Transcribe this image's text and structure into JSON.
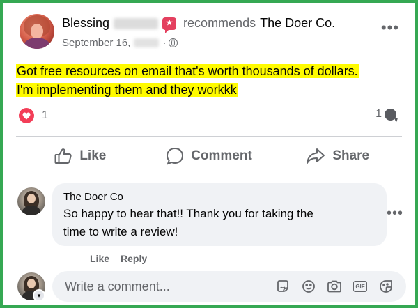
{
  "post": {
    "author_first_name": "Blessing",
    "recommends_text": "recommends",
    "page_name": "The Doer Co.",
    "date": "September 16,",
    "more_glyph": "•••",
    "text_line_1": "Got free resources on email that's worth thousands of dollars.",
    "text_line_2": "I'm implementing them and they workkk",
    "reaction_icon": "heart-icon",
    "reaction_count": "1",
    "comment_count": "1"
  },
  "actions": {
    "like_label": "Like",
    "comment_label": "Comment",
    "share_label": "Share"
  },
  "comment": {
    "author": "The Doer Co",
    "text_line_1": "So happy to hear that!! Thank you for taking the",
    "text_line_2": "time to write a review!",
    "like_label": "Like",
    "reply_label": "Reply",
    "more_glyph": "•••"
  },
  "composer": {
    "placeholder": "Write a comment...",
    "icons": [
      "sticker-comment-icon",
      "emoji-icon",
      "camera-icon",
      "gif-icon",
      "sticker-icon"
    ],
    "gif_label": "GIF"
  },
  "colors": {
    "frame_border": "#35a853",
    "highlight": "#fffb00",
    "love_reaction": "#f33e58",
    "secondary_text": "#65676b",
    "bubble_bg": "#f0f2f5"
  }
}
